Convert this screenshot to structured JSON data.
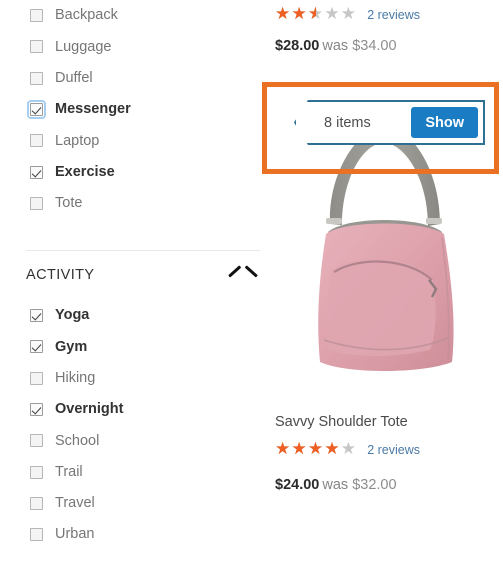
{
  "sidebar": {
    "style_filter": {
      "items": [
        {
          "label": "Backpack",
          "checked": false,
          "focused": false
        },
        {
          "label": "Luggage",
          "checked": false,
          "focused": false
        },
        {
          "label": "Duffel",
          "checked": false,
          "focused": false
        },
        {
          "label": "Messenger",
          "checked": true,
          "focused": true
        },
        {
          "label": "Laptop",
          "checked": false,
          "focused": false
        },
        {
          "label": "Exercise",
          "checked": true,
          "focused": false
        },
        {
          "label": "Tote",
          "checked": false,
          "focused": false
        }
      ]
    },
    "activity_filter": {
      "title": "ACTIVITY",
      "collapse_icon": "chevron-up-icon",
      "items": [
        {
          "label": "Yoga",
          "checked": true,
          "focused": false
        },
        {
          "label": "Gym",
          "checked": true,
          "focused": false
        },
        {
          "label": "Hiking",
          "checked": false,
          "focused": false
        },
        {
          "label": "Overnight",
          "checked": true,
          "focused": false
        },
        {
          "label": "School",
          "checked": false,
          "focused": false
        },
        {
          "label": "Trail",
          "checked": false,
          "focused": false
        },
        {
          "label": "Travel",
          "checked": false,
          "focused": false
        },
        {
          "label": "Urban",
          "checked": false,
          "focused": false
        }
      ]
    }
  },
  "products": {
    "top": {
      "rating_stars": 2.5,
      "rating_percent": "50%",
      "reviews_label": "2 reviews",
      "price_now": "$28.00",
      "price_was_prefix": "was",
      "price_old": "$34.00"
    },
    "bottom": {
      "name": "Savvy Shoulder Tote",
      "rating_stars": 4,
      "rating_percent": "80%",
      "reviews_label": "2 reviews",
      "price_now": "$24.00",
      "price_was_prefix": "was",
      "price_old": "$32.00",
      "image_alt": "pink-shoulder-bag-photo"
    }
  },
  "toolbar": {
    "limiter_value": "8 items",
    "show_label": "Show",
    "highlight_color": "#ea7024",
    "select_border_color": "#2e7093",
    "button_color": "#1a7dc4"
  },
  "colors": {
    "star_filled": "#ee5f23",
    "star_empty": "#c7c7c7",
    "link": "#4a7aa6",
    "label_muted": "#767676",
    "label_active": "#333333"
  }
}
